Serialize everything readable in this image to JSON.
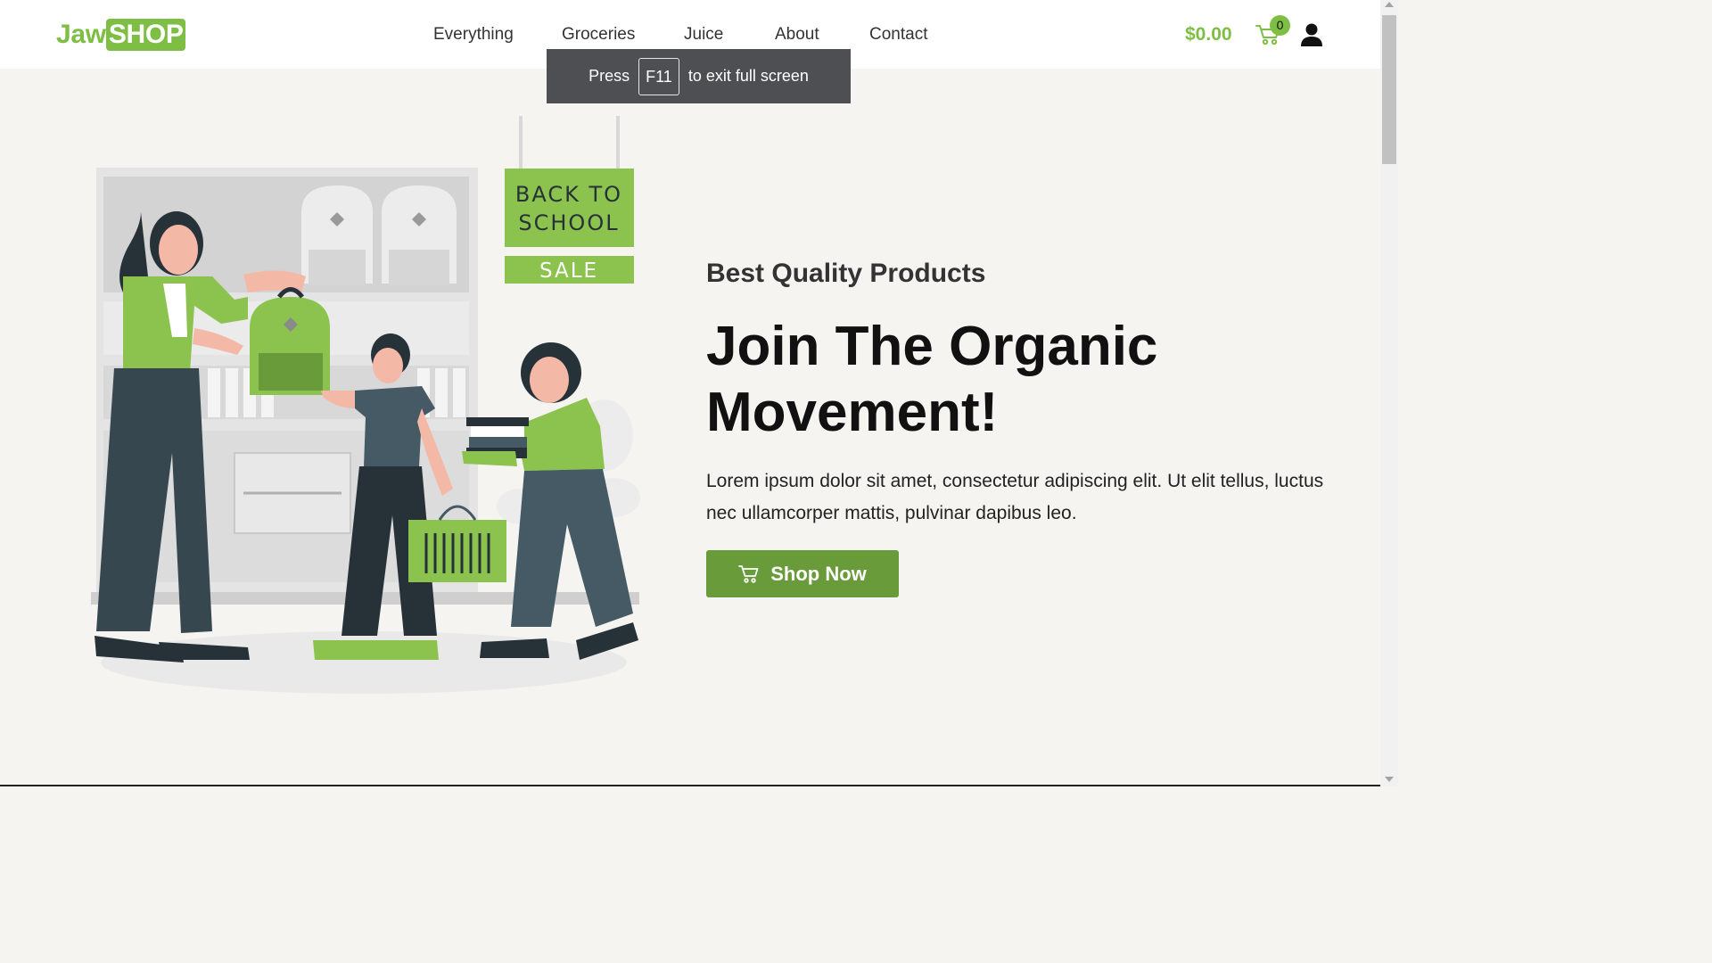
{
  "header": {
    "logo": {
      "part1": "Jaw",
      "part2": "SHOP"
    },
    "nav": [
      {
        "label": "Everything"
      },
      {
        "label": "Groceries"
      },
      {
        "label": "Juice"
      },
      {
        "label": "About"
      },
      {
        "label": "Contact"
      }
    ],
    "cart": {
      "total": "$0.00",
      "count": "0",
      "icon": "cart-icon"
    },
    "user_icon": "user-icon"
  },
  "fullscreen_notice": {
    "before": "Press",
    "key": "F11",
    "after": "to exit full screen"
  },
  "illustration": {
    "sign_line1": "BACK TO",
    "sign_line2": "SCHOOL",
    "sign_sale": "SALE"
  },
  "hero": {
    "subtitle": "Best Quality Products",
    "title": "Join The Organic Movement!",
    "text": "Lorem ipsum dolor sit amet, consectetur adipiscing elit. Ut elit tellus, luctus nec ullamcorper mattis, pulvinar dapibus leo.",
    "button_label": "Shop Now",
    "button_icon": "cart-icon"
  },
  "colors": {
    "brand": "#7fbe44",
    "button": "#6a9b3a",
    "background": "#f5f4f1"
  }
}
